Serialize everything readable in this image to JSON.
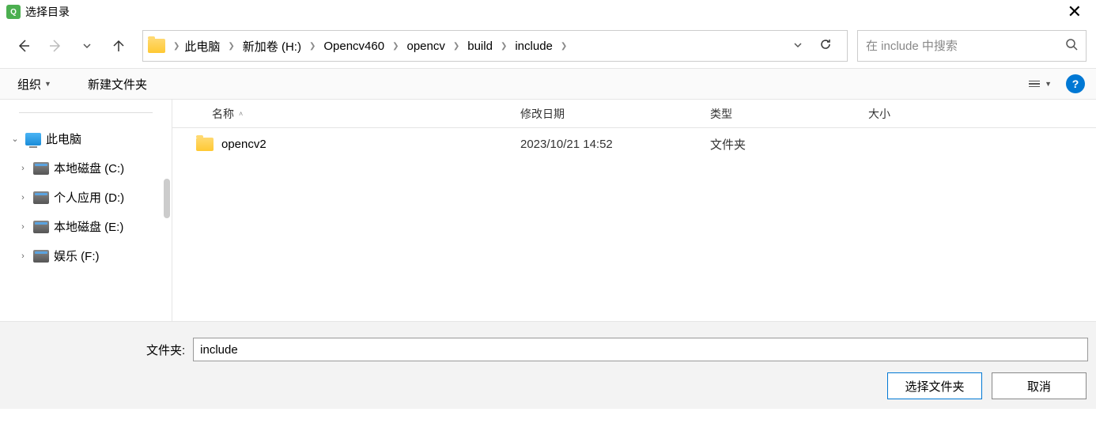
{
  "title": "选择目录",
  "breadcrumb": [
    "此电脑",
    "新加卷 (H:)",
    "Opencv460",
    "opencv",
    "build",
    "include"
  ],
  "search": {
    "placeholder": "在 include 中搜索"
  },
  "toolbar": {
    "organize": "组织",
    "new_folder": "新建文件夹"
  },
  "columns": {
    "name": "名称",
    "date": "修改日期",
    "type": "类型",
    "size": "大小"
  },
  "sidebar": {
    "root": "此电脑",
    "drives": [
      "本地磁盘 (C:)",
      "个人应用 (D:)",
      "本地磁盘 (E:)",
      "娱乐 (F:)"
    ]
  },
  "rows": [
    {
      "name": "opencv2",
      "date": "2023/10/21 14:52",
      "type": "文件夹",
      "size": ""
    }
  ],
  "footer": {
    "folder_label": "文件夹:",
    "folder_value": "include",
    "select": "选择文件夹",
    "cancel": "取消"
  }
}
